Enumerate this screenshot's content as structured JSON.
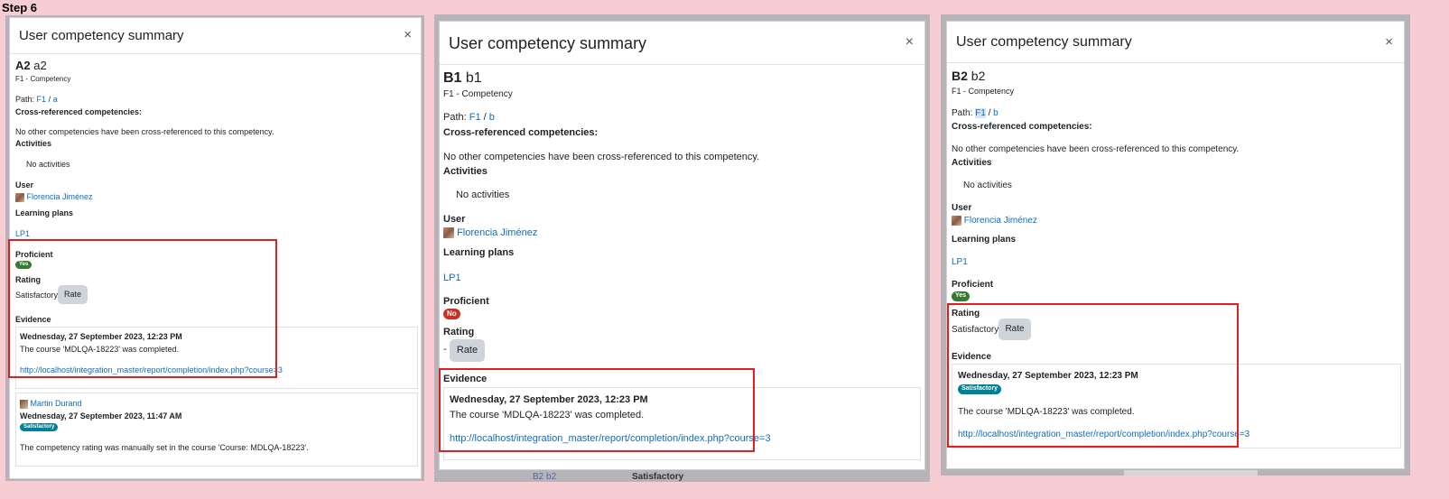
{
  "step_label": "Step 6",
  "panels": [
    {
      "title": "User competency summary",
      "close": "×",
      "competency_code": "A2",
      "competency_name": "a2",
      "framework": "F1 - Competency",
      "path_label": "Path:",
      "path_root": "F1",
      "path_sep": "/",
      "path_leaf": "a",
      "cross_ref_label": "Cross-referenced competencies:",
      "cross_ref_text": "No other competencies have been cross-referenced to this competency.",
      "activities_label": "Activities",
      "activities_text": "No activities",
      "user_label": "User",
      "user_name": "Florencia Jiménez",
      "learning_plans_label": "Learning plans",
      "learning_plan": "LP1",
      "proficient_label": "Proficient",
      "proficient_value": "Yes",
      "rating_label": "Rating",
      "rating_value": "Satisfactory",
      "rate_button": "Rate",
      "evidence_label": "Evidence",
      "evidence": [
        {
          "date": "Wednesday, 27 September 2023, 12:23 PM",
          "text": "The course 'MDLQA-18223' was completed.",
          "link": "http://localhost/integration_master/report/completion/index.php?course=3"
        },
        {
          "author": "Martin Durand",
          "date": "Wednesday, 27 September 2023, 11:47 AM",
          "badge": "Satisfactory",
          "text": "The competency rating was manually set in the course 'Course: MDLQA-18223'."
        }
      ]
    },
    {
      "title": "User competency summary",
      "close": "×",
      "competency_code": "B1",
      "competency_name": "b1",
      "framework": "F1 - Competency",
      "path_label": "Path:",
      "path_root": "F1",
      "path_sep": "/",
      "path_leaf": "b",
      "cross_ref_label": "Cross-referenced competencies:",
      "cross_ref_text": "No other competencies have been cross-referenced to this competency.",
      "activities_label": "Activities",
      "activities_text": "No activities",
      "user_label": "User",
      "user_name": "Florencia Jiménez",
      "learning_plans_label": "Learning plans",
      "learning_plan": "LP1",
      "proficient_label": "Proficient",
      "proficient_value": "No",
      "rating_label": "Rating",
      "rating_value": "-",
      "rate_button": "Rate",
      "evidence_label": "Evidence",
      "evidence": [
        {
          "date": "Wednesday, 27 September 2023, 12:23 PM",
          "text": "The course 'MDLQA-18223' was completed.",
          "link": "http://localhost/integration_master/report/completion/index.php?course=3"
        }
      ],
      "background_text_left": "B2 b2",
      "background_text_right": "Satisfactory"
    },
    {
      "title": "User competency summary",
      "close": "×",
      "competency_code": "B2",
      "competency_name": "b2",
      "framework": "F1 - Competency",
      "path_label": "Path:",
      "path_root": "F1",
      "path_sep": "/",
      "path_leaf": "b",
      "cross_ref_label": "Cross-referenced competencies:",
      "cross_ref_text": "No other competencies have been cross-referenced to this competency.",
      "activities_label": "Activities",
      "activities_text": "No activities",
      "user_label": "User",
      "user_name": "Florencia Jiménez",
      "learning_plans_label": "Learning plans",
      "learning_plan": "LP1",
      "proficient_label": "Proficient",
      "proficient_value": "Yes",
      "rating_label": "Rating",
      "rating_value": "Satisfactory",
      "rate_button": "Rate",
      "evidence_label": "Evidence",
      "evidence": [
        {
          "date": "Wednesday, 27 September 2023, 12:23 PM",
          "badge": "Satisfactory",
          "text": "The course 'MDLQA-18223' was completed.",
          "link": "http://localhost/integration_master/report/completion/index.php?course=3"
        }
      ]
    }
  ],
  "colors": {
    "page_bg": "#f7cdd3",
    "highlight": "#e0201e",
    "link": "#0f6cbf",
    "yes_badge": "#357a32",
    "no_badge": "#ca3120",
    "satisfactory_badge": "#008196"
  }
}
